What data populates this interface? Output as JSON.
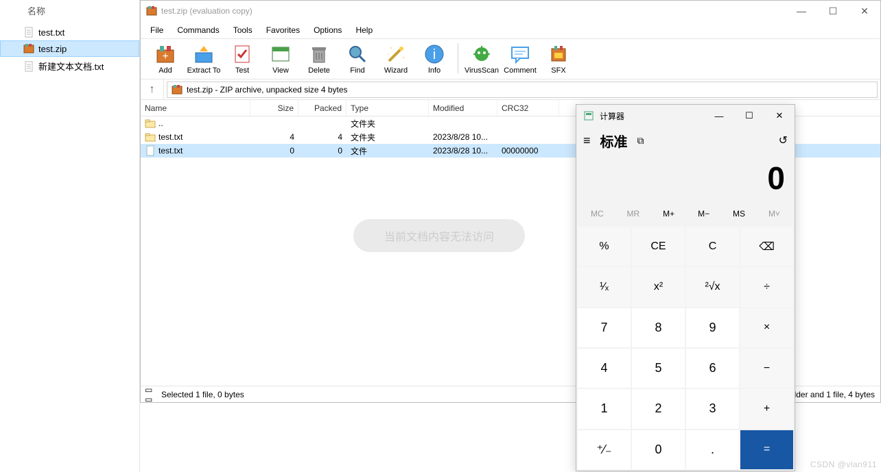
{
  "explorer": {
    "header": "名称",
    "items": [
      {
        "icon": "text-file-icon",
        "label": "test.txt",
        "sel": false
      },
      {
        "icon": "rar-icon",
        "label": "test.zip",
        "sel": true
      },
      {
        "icon": "text-file-icon",
        "label": "新建文本文档.txt",
        "sel": false
      }
    ]
  },
  "winrar": {
    "title": "test.zip (evaluation copy)",
    "menu": [
      "File",
      "Commands",
      "Tools",
      "Favorites",
      "Options",
      "Help"
    ],
    "toolbar": [
      {
        "label": "Add",
        "icon": "add-icon"
      },
      {
        "label": "Extract To",
        "icon": "extract-icon"
      },
      {
        "label": "Test",
        "icon": "test-icon"
      },
      {
        "label": "View",
        "icon": "view-icon"
      },
      {
        "label": "Delete",
        "icon": "delete-icon"
      },
      {
        "label": "Find",
        "icon": "find-icon"
      },
      {
        "label": "Wizard",
        "icon": "wizard-icon"
      },
      {
        "label": "Info",
        "icon": "info-icon"
      },
      {
        "sep": true
      },
      {
        "label": "VirusScan",
        "icon": "virus-icon"
      },
      {
        "label": "Comment",
        "icon": "comment-icon"
      },
      {
        "label": "SFX",
        "icon": "sfx-icon"
      }
    ],
    "path": "test.zip - ZIP archive, unpacked size 4 bytes",
    "columns": {
      "name": "Name",
      "size": "Size",
      "packed": "Packed",
      "type": "Type",
      "modified": "Modified",
      "crc": "CRC32"
    },
    "rows": [
      {
        "icon": "folder-icon",
        "name": "..",
        "size": "",
        "packed": "",
        "type": "文件夹",
        "mod": "",
        "crc": "",
        "sel": false
      },
      {
        "icon": "folder-icon",
        "name": "test.txt",
        "size": "4",
        "packed": "4",
        "type": "文件夹",
        "mod": "2023/8/28 10...",
        "crc": "",
        "sel": false
      },
      {
        "icon": "file-icon",
        "name": "test.txt",
        "size": "0",
        "packed": "0",
        "type": "文件",
        "mod": "2023/8/28 10...",
        "crc": "00000000",
        "sel": true
      }
    ],
    "status_left": "Selected 1 file, 0 bytes",
    "status_right": "Total 1 folder and 1 file, 4 bytes",
    "pill": "当前文档内容无法访问"
  },
  "calc": {
    "title": "计算器",
    "mode": "标准",
    "display": "0",
    "memory": [
      "MC",
      "MR",
      "M+",
      "M−",
      "MS",
      "M˅"
    ],
    "memory_enabled": [
      false,
      false,
      true,
      true,
      true,
      false
    ],
    "buttons": [
      [
        "%",
        "CE",
        "C",
        "⌫"
      ],
      [
        "¹⁄ₓ",
        "x²",
        "²√x",
        "÷"
      ],
      [
        "7",
        "8",
        "9",
        "×"
      ],
      [
        "4",
        "5",
        "6",
        "−"
      ],
      [
        "1",
        "2",
        "3",
        "+"
      ],
      [
        "⁺⁄₋",
        "0",
        ".",
        "="
      ]
    ]
  },
  "watermark": "CSDN @vlan911"
}
